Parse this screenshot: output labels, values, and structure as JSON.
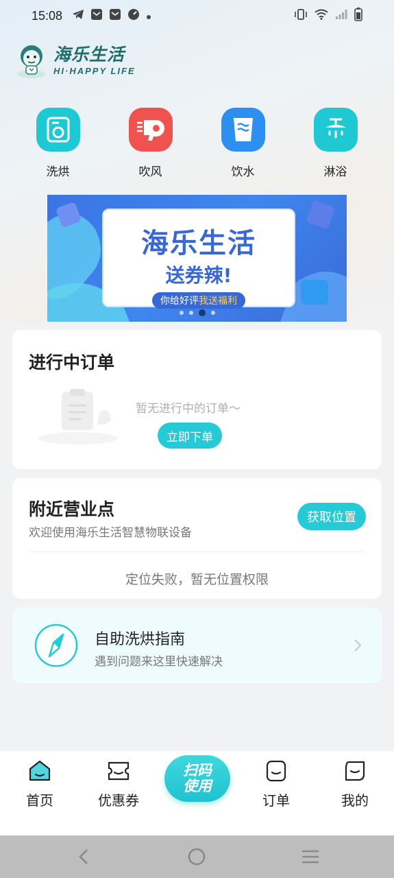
{
  "status_bar": {
    "time": "15:08"
  },
  "logo": {
    "name_cn": "海乐生活",
    "name_en": "HI·HAPPY LIFE"
  },
  "quick_actions": [
    {
      "label": "洗烘",
      "icon": "washer-icon",
      "color": "#1ec9d4"
    },
    {
      "label": "吹风",
      "icon": "hair-dryer-icon",
      "color": "#f0524f"
    },
    {
      "label": "饮水",
      "icon": "water-cup-icon",
      "color": "#2d8ff0"
    },
    {
      "label": "淋浴",
      "icon": "shower-icon",
      "color": "#1ec9d4"
    }
  ],
  "banner": {
    "title": "海乐生活",
    "subtitle": "送券辣!",
    "pill_prefix": "你给好评",
    "pill_highlight": "我送福利",
    "page_count": 4,
    "active_page": 3
  },
  "orders": {
    "title": "进行中订单",
    "empty_text": "暂无进行中的订单～",
    "order_button": "立即下单"
  },
  "nearby": {
    "title": "附近营业点",
    "subtitle": "欢迎使用海乐生活智慧物联设备",
    "location_button": "获取位置",
    "status": "定位失败，暂无位置权限"
  },
  "guide": {
    "title": "自助洗烘指南",
    "subtitle": "遇到问题来这里快速解决"
  },
  "bottom_nav": {
    "home": "首页",
    "coupons": "优惠券",
    "scan": "扫码使用",
    "orders": "订单",
    "mine": "我的"
  },
  "colors": {
    "accent": "#25cad6",
    "brand_dark": "#1d6e6a",
    "banner_blue": "#3867d6"
  }
}
